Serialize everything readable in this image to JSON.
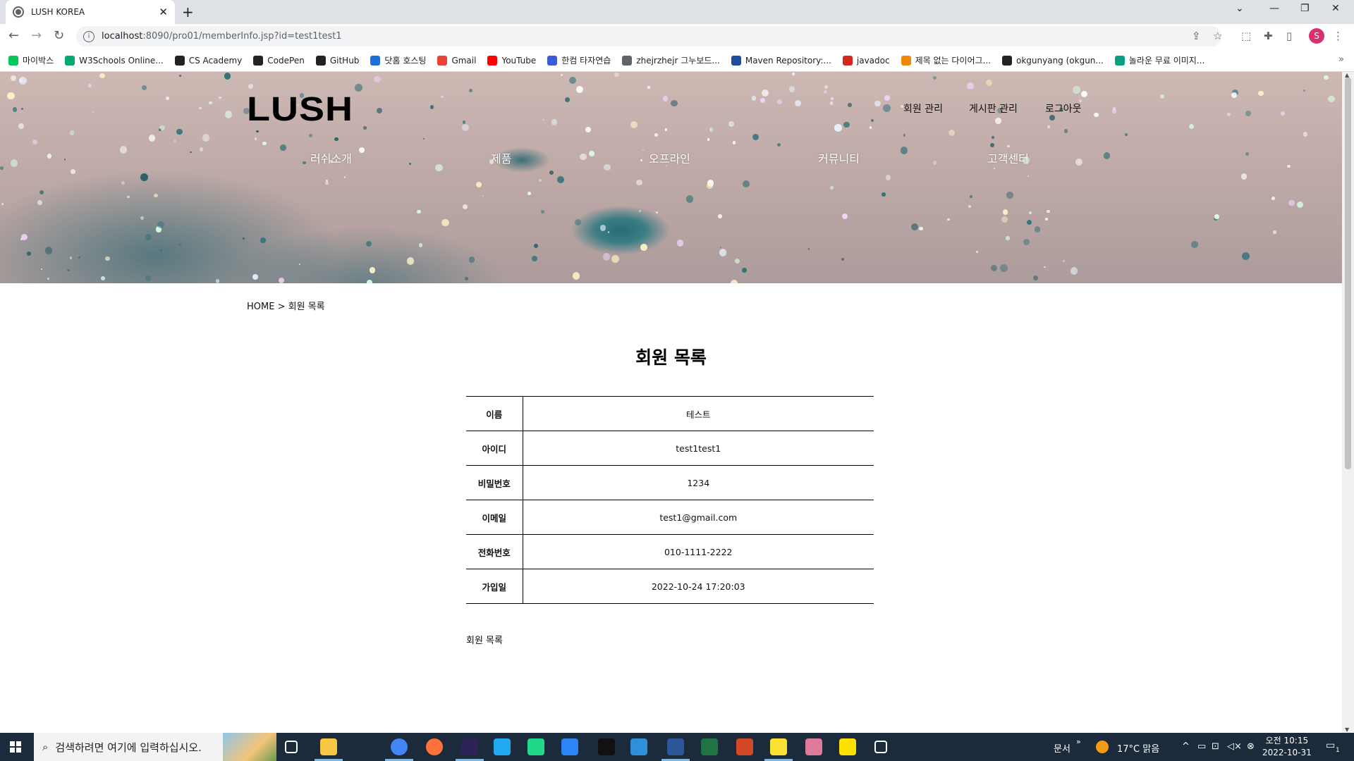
{
  "browser": {
    "tab_title": "LUSH KOREA",
    "new_tab": "+",
    "url_host": "localhost",
    "url_rest": ":8090/pro01/memberInfo.jsp?id=test1test1",
    "profile_initial": "S",
    "bookmarks": [
      {
        "label": "마이박스",
        "color": "#03c75a"
      },
      {
        "label": "W3Schools Online...",
        "color": "#04aa6d"
      },
      {
        "label": "CS Academy",
        "color": "#222222"
      },
      {
        "label": "CodePen",
        "color": "#222222"
      },
      {
        "label": "GitHub",
        "color": "#222222"
      },
      {
        "label": "닷홈 호스팅",
        "color": "#1e6fd9"
      },
      {
        "label": "Gmail",
        "color": "#ea4335"
      },
      {
        "label": "YouTube",
        "color": "#ff0000"
      },
      {
        "label": "한컴 타자연습",
        "color": "#3b5bdb"
      },
      {
        "label": "zhejrzhejr 그누보드...",
        "color": "#5f6368"
      },
      {
        "label": "Maven Repository:...",
        "color": "#1f4e9c"
      },
      {
        "label": "javadoc",
        "color": "#d7261e"
      },
      {
        "label": "제목 없는 다이어그...",
        "color": "#f08705"
      },
      {
        "label": "okgunyang (okgun...",
        "color": "#222222"
      },
      {
        "label": "놀라운 무료 이미지...",
        "color": "#05a081"
      }
    ],
    "bookmarks_more": "»"
  },
  "site": {
    "logo": "LUSH",
    "top_menu": [
      "회원 관리",
      "게시판 관리",
      "로그아웃"
    ],
    "gnb": [
      "러쉬소개",
      "제품",
      "오프라인",
      "커뮤니티",
      "고객센터"
    ],
    "breadcrumb": "HOME > 회원 목록",
    "page_title": "회원 목록",
    "member": {
      "rows": [
        {
          "label": "이름",
          "value": "테스트"
        },
        {
          "label": "아이디",
          "value": "test1test1"
        },
        {
          "label": "비밀번호",
          "value": "1234"
        },
        {
          "label": "이메일",
          "value": "test1@gmail.com"
        },
        {
          "label": "전화번호",
          "value": "010-1111-2222"
        },
        {
          "label": "가입일",
          "value": "2022-10-24 17:20:03"
        }
      ]
    },
    "list_link": "회원 목록"
  },
  "taskbar": {
    "search_placeholder": "검색하려면 여기에 입력하십시오.",
    "tray_docs": "문서",
    "weather": "17°C 맑음",
    "time": "오전 10:15",
    "date": "2022-10-31",
    "notification_count": "1",
    "colors": {
      "taskview": "#ffffff",
      "explorer": "#f6c744",
      "chrome": "#4285f4",
      "firefox": "#ff7139",
      "eclipse": "#2c2255",
      "vscode": "#23a9f2",
      "pycharm": "#21d789",
      "sourcetree": "#2d84f4",
      "terminal": "#111111",
      "vmware": "#2f8fd8",
      "word": "#2b579a",
      "excel": "#217346",
      "powerpoint": "#d24726",
      "sticky": "#f9e231",
      "paint": "#e07a9a",
      "kakao": "#fae100",
      "settings": "#ffffff"
    }
  }
}
